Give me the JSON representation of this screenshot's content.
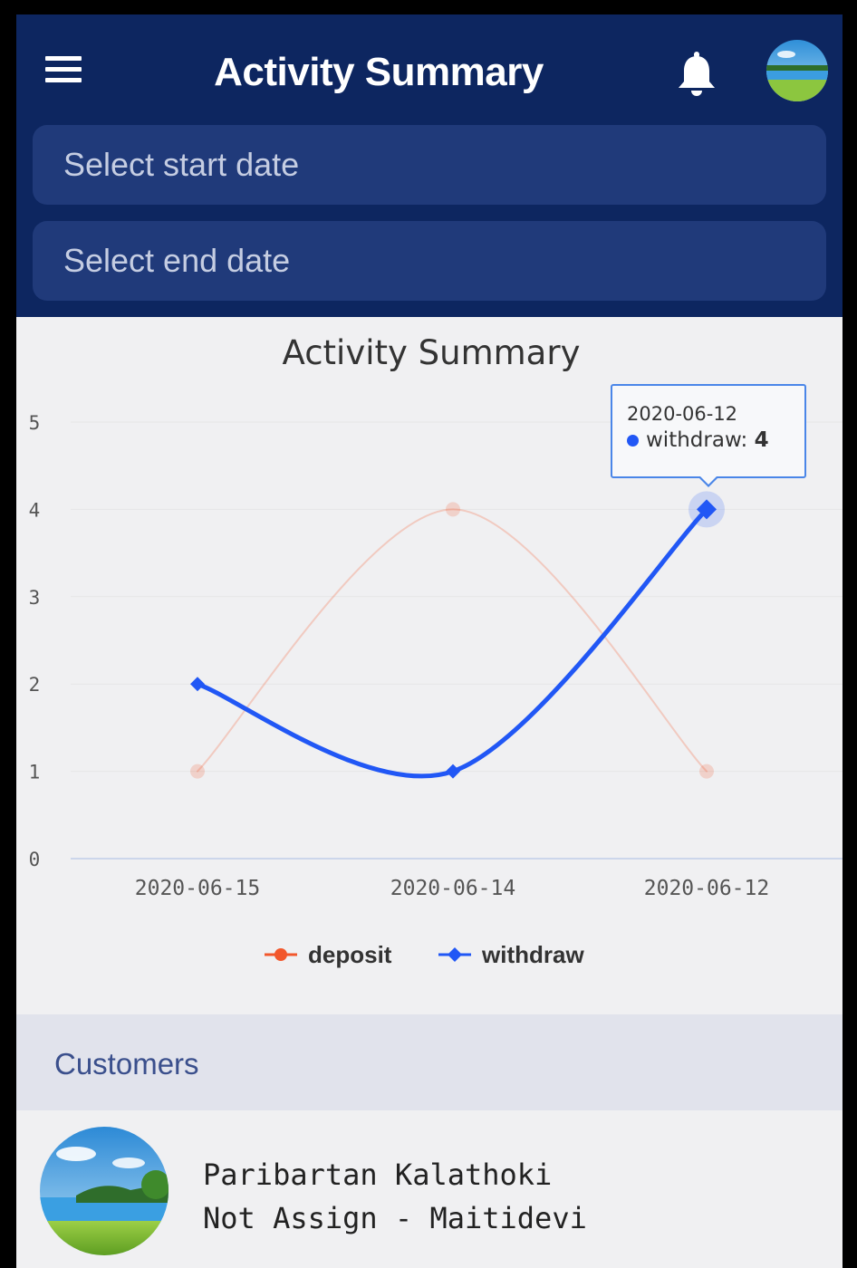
{
  "header": {
    "title": "Activity Summary",
    "start_date_placeholder": "Select start date",
    "end_date_placeholder": "Select end date"
  },
  "chart_data": {
    "type": "line",
    "title": "Activity Summary",
    "categories": [
      "2020-06-15",
      "2020-06-14",
      "2020-06-12"
    ],
    "series": [
      {
        "name": "deposit",
        "values": [
          1,
          4,
          1
        ],
        "color": "#f2572c",
        "state": "faded"
      },
      {
        "name": "withdraw",
        "values": [
          2,
          1,
          4
        ],
        "color": "#2157f5",
        "state": "highlighted"
      }
    ],
    "y_ticks": [
      "0",
      "1",
      "2",
      "3",
      "4",
      "5"
    ],
    "ylim": [
      0,
      5
    ],
    "grid": true,
    "legend_placement": "bottom-center",
    "tooltip": {
      "date": "2020-06-12",
      "series": "withdraw",
      "label": "withdraw:",
      "value": "4"
    }
  },
  "customers": {
    "title": "Customers",
    "items": [
      {
        "name": "Paribartan Kalathoki",
        "subtitle": "Not Assign - Maitidevi"
      }
    ]
  }
}
